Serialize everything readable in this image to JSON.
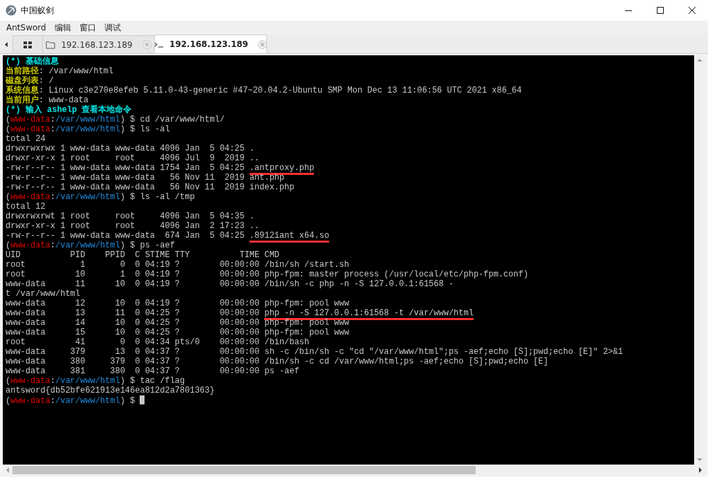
{
  "window": {
    "title": "中国蚁剑"
  },
  "menu": [
    "AntSword",
    "编辑",
    "窗口",
    "调试"
  ],
  "tabs": [
    {
      "kind": "home",
      "selected": false
    },
    {
      "kind": "files",
      "label": "192.168.123.189",
      "selected": false
    },
    {
      "kind": "terminal",
      "label": "192.168.123.189",
      "selected": true
    }
  ],
  "terminal": {
    "cursor": true,
    "lines": [
      {
        "segments": [
          {
            "kind": "banner",
            "text": "(*) 基础信息"
          }
        ]
      },
      {
        "segments": [
          {
            "kind": "label",
            "text": "当前路径"
          },
          {
            "kind": "text",
            "text": ": /var/www/html"
          }
        ]
      },
      {
        "segments": [
          {
            "kind": "label",
            "text": "磁盘列表"
          },
          {
            "kind": "text",
            "text": ": /"
          }
        ]
      },
      {
        "segments": [
          {
            "kind": "label",
            "text": "系统信息"
          },
          {
            "kind": "text",
            "text": ": Linux c3e270e8efeb 5.11.0-43-generic #47~20.04.2-Ubuntu SMP Mon Dec 13 11:06:56 UTC 2021 x86_64"
          }
        ]
      },
      {
        "segments": [
          {
            "kind": "label",
            "text": "当前用户"
          },
          {
            "kind": "text",
            "text": ": www-data"
          }
        ]
      },
      {
        "segments": [
          {
            "kind": "banner",
            "text": "(*) 输入 ashelp 查看本地命令"
          }
        ]
      },
      {
        "segments": [
          {
            "kind": "text",
            "text": "("
          },
          {
            "kind": "user",
            "text": "www-data"
          },
          {
            "kind": "text",
            "text": ":"
          },
          {
            "kind": "path",
            "text": "/var/www/html"
          },
          {
            "kind": "text",
            "text": ") $ cd /var/www/html/"
          }
        ]
      },
      {
        "segments": [
          {
            "kind": "text",
            "text": "("
          },
          {
            "kind": "user",
            "text": "www-data"
          },
          {
            "kind": "text",
            "text": ":"
          },
          {
            "kind": "path",
            "text": "/var/www/html"
          },
          {
            "kind": "text",
            "text": ") $ ls -al"
          }
        ]
      },
      {
        "segments": [
          {
            "kind": "text",
            "text": "total 24"
          }
        ]
      },
      {
        "segments": [
          {
            "kind": "text",
            "text": "drwxrwxrwx 1 www-data www-data 4096 Jan  5 04:25 ."
          }
        ]
      },
      {
        "segments": [
          {
            "kind": "text",
            "text": "drwxr-xr-x 1 root     root     4096 Jul  9  2019 .."
          }
        ]
      },
      {
        "segments": [
          {
            "kind": "text",
            "text": "-rw-r--r-- 1 www-data www-data 1754 Jan  5 04:25 "
          },
          {
            "kind": "underlined",
            "text": ".antproxy.php"
          }
        ]
      },
      {
        "segments": [
          {
            "kind": "text",
            "text": "-rw-r--r-- 1 www-data www-data   56 Nov 11  2019 ant.php"
          }
        ]
      },
      {
        "segments": [
          {
            "kind": "text",
            "text": "-rw-r--r-- 1 www-data www-data   56 Nov 11  2019 index.php"
          }
        ]
      },
      {
        "segments": [
          {
            "kind": "text",
            "text": "("
          },
          {
            "kind": "user",
            "text": "www-data"
          },
          {
            "kind": "text",
            "text": ":"
          },
          {
            "kind": "path",
            "text": "/var/www/html"
          },
          {
            "kind": "text",
            "text": ") $ ls -al /tmp"
          }
        ]
      },
      {
        "segments": [
          {
            "kind": "text",
            "text": "total 12"
          }
        ]
      },
      {
        "segments": [
          {
            "kind": "text",
            "text": "drwxrwxrwt 1 root     root     4096 Jan  5 04:35 ."
          }
        ]
      },
      {
        "segments": [
          {
            "kind": "text",
            "text": "drwxr-xr-x 1 root     root     4096 Jan  2 17:23 .."
          }
        ]
      },
      {
        "segments": [
          {
            "kind": "text",
            "text": "-rw-r--r-- 1 www-data www-data  674 Jan  5 04:25 "
          },
          {
            "kind": "underlined",
            "text": ".89121ant x64.so"
          }
        ]
      },
      {
        "segments": [
          {
            "kind": "text",
            "text": "("
          },
          {
            "kind": "user",
            "text": "www-data"
          },
          {
            "kind": "text",
            "text": ":"
          },
          {
            "kind": "path",
            "text": "/var/www/html"
          },
          {
            "kind": "text",
            "text": ") $ ps -aef"
          }
        ]
      },
      {
        "segments": [
          {
            "kind": "text",
            "text": "UID          PID    PPID  C STIME TTY          TIME CMD"
          }
        ]
      },
      {
        "segments": [
          {
            "kind": "text",
            "text": "root           1       0  0 04:19 ?        00:00:00 /bin/sh /start.sh"
          }
        ]
      },
      {
        "segments": [
          {
            "kind": "text",
            "text": "root          10       1  0 04:19 ?        00:00:00 php-fpm: master process (/usr/local/etc/php-fpm.conf)"
          }
        ]
      },
      {
        "segments": [
          {
            "kind": "text",
            "text": "www-data      11      10  0 04:19 ?        00:00:00 /bin/sh -c php -n -S 127.0.0.1:61568 -"
          }
        ]
      },
      {
        "segments": [
          {
            "kind": "text",
            "text": "t /var/www/html"
          }
        ]
      },
      {
        "segments": [
          {
            "kind": "text",
            "text": "www-data      12      10  0 04:19 ?        00:00:00 php-fpm: pool www"
          }
        ]
      },
      {
        "segments": [
          {
            "kind": "text",
            "text": "www-data      13      11  0 04:25 ?        00:00:00 "
          },
          {
            "kind": "underlined",
            "text": "php -n -S 127.0.0.1:61568 -t /var/www/html"
          }
        ]
      },
      {
        "segments": [
          {
            "kind": "text",
            "text": "www-data      14      10  0 04:25 ?        00:00:00 php-fpm: pool www"
          }
        ]
      },
      {
        "segments": [
          {
            "kind": "text",
            "text": "www-data      15      10  0 04:25 ?        00:00:00 php-fpm: pool www"
          }
        ]
      },
      {
        "segments": [
          {
            "kind": "text",
            "text": "root          41       0  0 04:34 pts/0    00:00:00 /bin/bash"
          }
        ]
      },
      {
        "segments": [
          {
            "kind": "text",
            "text": "www-data     379      13  0 04:37 ?        00:00:00 sh -c /bin/sh -c \"cd \"/var/www/html\";ps -aef;echo [S];pwd;echo [E]\" 2>&1"
          }
        ]
      },
      {
        "segments": [
          {
            "kind": "text",
            "text": "www-data     380     379  0 04:37 ?        00:00:00 /bin/sh -c cd /var/www/html;ps -aef;echo [S];pwd;echo [E]"
          }
        ]
      },
      {
        "segments": [
          {
            "kind": "text",
            "text": "www-data     381     380  0 04:37 ?        00:00:00 ps -aef"
          }
        ]
      },
      {
        "segments": [
          {
            "kind": "text",
            "text": "("
          },
          {
            "kind": "user",
            "text": "www-data"
          },
          {
            "kind": "text",
            "text": ":"
          },
          {
            "kind": "path",
            "text": "/var/www/html"
          },
          {
            "kind": "text",
            "text": ") $ tac /flag"
          }
        ]
      },
      {
        "segments": [
          {
            "kind": "text",
            "text": "antsword{db52bfe621913e146ea812d2a7801363}"
          }
        ]
      },
      {
        "segments": [
          {
            "kind": "text",
            "text": "("
          },
          {
            "kind": "user",
            "text": "www-data"
          },
          {
            "kind": "text",
            "text": ":"
          },
          {
            "kind": "path",
            "text": "/var/www/html"
          },
          {
            "kind": "text",
            "text": ") $ "
          }
        ]
      }
    ]
  }
}
